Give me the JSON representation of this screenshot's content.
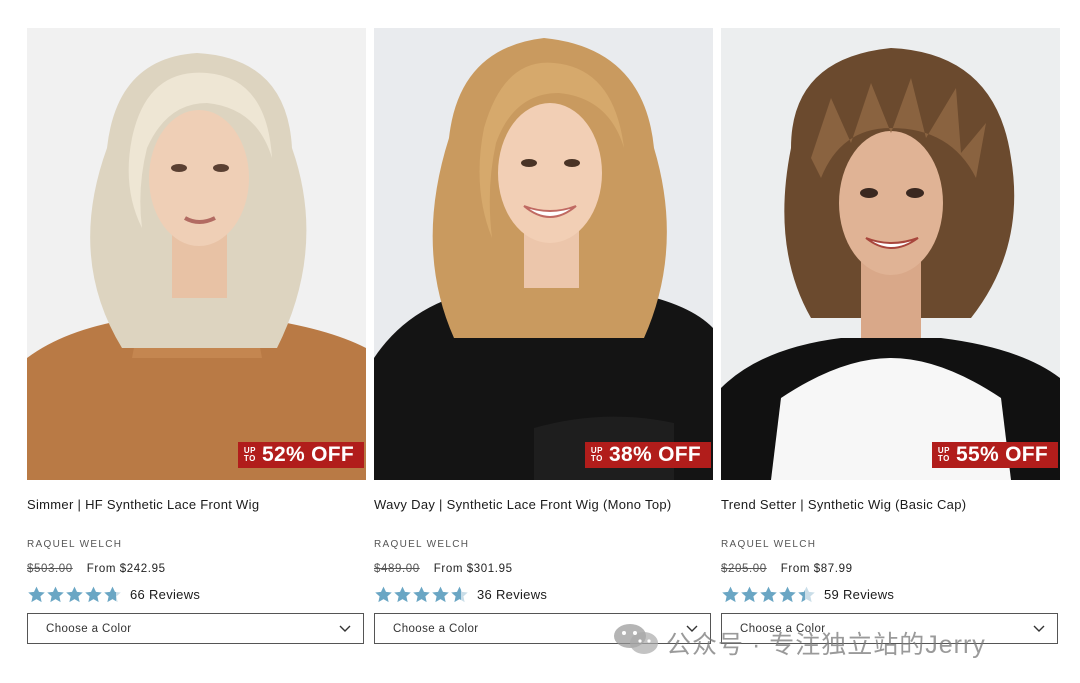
{
  "products": [
    {
      "title": "Simmer | HF Synthetic Lace Front Wig",
      "brand": "RAQUEL WELCH",
      "old_price": "$503.00",
      "price": "From $242.95",
      "rating": 4.7,
      "reviews": "66 Reviews",
      "badge": {
        "upto_1": "UP",
        "upto_2": "TO",
        "discount": "52% OFF"
      },
      "select_label": "Choose a Color"
    },
    {
      "title": "Wavy Day | Synthetic Lace Front Wig (Mono Top)",
      "brand": "RAQUEL WELCH",
      "old_price": "$489.00",
      "price": "From $301.95",
      "rating": 4.6,
      "reviews": "36 Reviews",
      "badge": {
        "upto_1": "UP",
        "upto_2": "TO",
        "discount": "38% OFF"
      },
      "select_label": "Choose a Color"
    },
    {
      "title": "Trend Setter | Synthetic Wig (Basic Cap)",
      "brand": "RAQUEL WELCH",
      "old_price": "$205.00",
      "price": "From $87.99",
      "rating": 4.4,
      "reviews": "59 Reviews",
      "badge": {
        "upto_1": "UP",
        "upto_2": "TO",
        "discount": "55% OFF"
      },
      "select_label": "Choose a Color"
    }
  ],
  "watermark": "公众号 · 专注独立站的Jerry",
  "colors": {
    "badge_red": "#b11d1b",
    "star_blue": "#6aa6c4",
    "star_empty": "#c9dde8"
  },
  "icons": {
    "star": "star-icon",
    "chevron": "chevron-down-icon",
    "wechat": "wechat-icon"
  }
}
